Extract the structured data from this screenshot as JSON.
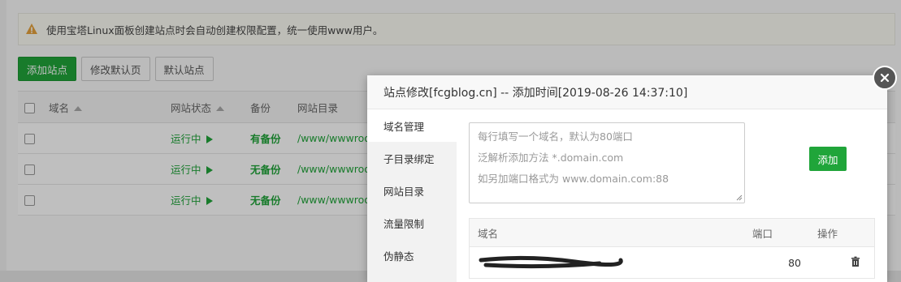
{
  "alert": {
    "icon": "warning-icon",
    "text": "使用宝塔Linux面板创建站点时会自动创建权限配置，统一使用www用户。"
  },
  "toolbar": {
    "add_site": "添加站点",
    "edit_default_page": "修改默认页",
    "default_site": "默认站点"
  },
  "site_table": {
    "headers": {
      "domain": "域名",
      "status": "网站状态",
      "backup": "备份",
      "dir": "网站目录"
    },
    "rows": [
      {
        "status": "运行中",
        "backup": "有备份",
        "dir": "/www/wwwroo"
      },
      {
        "status": "运行中",
        "backup": "无备份",
        "dir": "/www/wwwroo"
      },
      {
        "status": "运行中",
        "backup": "无备份",
        "dir": "/www/wwwroo"
      }
    ]
  },
  "modal": {
    "title": "站点修改[fcgblog.cn] -- 添加时间[2019-08-26 14:37:10]",
    "menu": [
      "域名管理",
      "子目录绑定",
      "网站目录",
      "流量限制",
      "伪静态"
    ],
    "textarea_lines": [
      "每行填写一个域名，默认为80端口",
      "泛解析添加方法 *.domain.com",
      "如另加端口格式为 www.domain.com:88"
    ],
    "add_button": "添加",
    "domain_table": {
      "headers": {
        "domain": "域名",
        "port": "端口",
        "action": "操作"
      },
      "rows": [
        {
          "port": "80"
        }
      ]
    }
  },
  "colors": {
    "accent": "#20a53a",
    "warning": "#e6a23c"
  }
}
